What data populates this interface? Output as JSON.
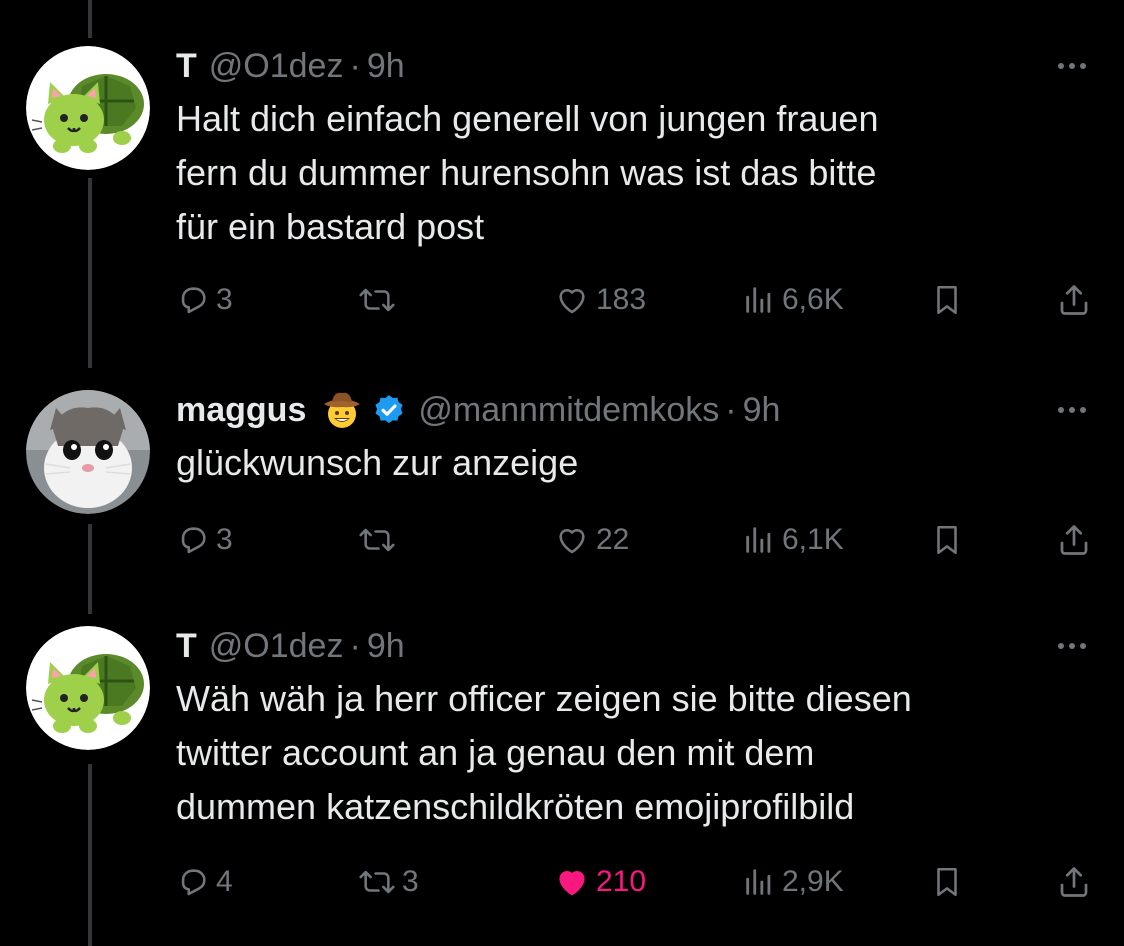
{
  "tweets": [
    {
      "name": "T",
      "handle": "@O1dez",
      "dot": "·",
      "time": "9h",
      "text": "Halt dich einfach generell von jungen frauen\nfern du dummer hurensohn was ist das bitte\nfür ein bastard post",
      "avatar": "cat-turtle-emoji",
      "verified": false,
      "stats": {
        "replies": "3",
        "reposts": "",
        "likes": "183",
        "views": "6,6K"
      },
      "liked": false
    },
    {
      "name": "maggus",
      "handle": "@mannmitdemkoks",
      "dot": "·",
      "time": "9h",
      "text": "glückwunsch zur anzeige",
      "avatar": "cat-photo",
      "name_emoji": "cowboy-hat-face-emoji",
      "verified": true,
      "stats": {
        "replies": "3",
        "reposts": "",
        "likes": "22",
        "views": "6,1K"
      },
      "liked": false
    },
    {
      "name": "T",
      "handle": "@O1dez",
      "dot": "·",
      "time": "9h",
      "text": "Wäh wäh ja herr officer zeigen sie bitte diesen\ntwitter account an ja genau den mit dem\ndummen katzenschildkröten emojiprofilbild",
      "avatar": "cat-turtle-emoji",
      "verified": false,
      "stats": {
        "replies": "4",
        "reposts": "3",
        "likes": "210",
        "views": "2,9K"
      },
      "liked": true
    }
  ],
  "colors": {
    "background": "#000000",
    "text": "#e7e9ea",
    "muted": "#71767b",
    "like_active": "#f91880",
    "verified": "#1d9bf0",
    "thread_line": "#333639"
  }
}
